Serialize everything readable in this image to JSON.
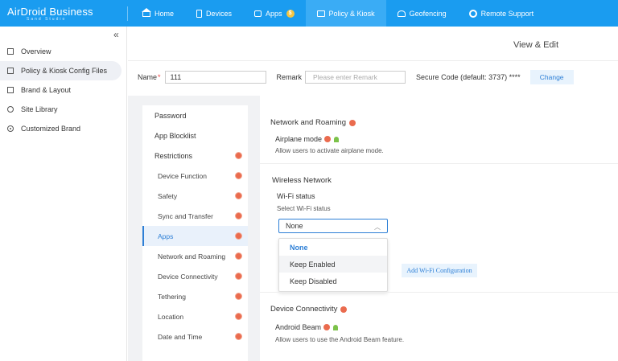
{
  "brand": {
    "title": "AirDroid Business",
    "subtitle": "Sand Studio"
  },
  "nav": [
    {
      "label": "Home",
      "icon": "home-icon"
    },
    {
      "label": "Devices",
      "icon": "device-icon"
    },
    {
      "label": "Apps",
      "icon": "apps-icon",
      "badge": "$"
    },
    {
      "label": "Policy & Kiosk",
      "icon": "folder-icon",
      "active": true
    },
    {
      "label": "Geofencing",
      "icon": "geofence-icon"
    },
    {
      "label": "Remote Support",
      "icon": "support-icon"
    }
  ],
  "sidebar": {
    "collapse": "«",
    "items": [
      {
        "label": "Overview",
        "icon": "overview-icon"
      },
      {
        "label": "Policy & Kiosk Config Files",
        "icon": "config-files-icon",
        "active": true
      },
      {
        "label": "Brand & Layout",
        "icon": "brand-icon"
      },
      {
        "label": "Site Library",
        "icon": "globe-icon"
      },
      {
        "label": "Customized Brand",
        "icon": "custom-brand-icon"
      }
    ]
  },
  "header": {
    "view_edit": "View & Edit"
  },
  "form": {
    "name_label": "Name",
    "required_mark": "*",
    "name_value": "111",
    "remark_label": "Remark",
    "remark_placeholder": "Please enter Remark",
    "secure_code": "Secure Code (default: 3737) ****",
    "change_label": "Change"
  },
  "tree": [
    {
      "label": "Password",
      "sub": false,
      "badge": false
    },
    {
      "label": "App Blocklist",
      "sub": false,
      "badge": false
    },
    {
      "label": "Restrictions",
      "sub": false,
      "badge": true
    },
    {
      "label": "Device Function",
      "sub": true,
      "badge": true
    },
    {
      "label": "Safety",
      "sub": true,
      "badge": true
    },
    {
      "label": "Sync and Transfer",
      "sub": true,
      "badge": true
    },
    {
      "label": "Apps",
      "sub": true,
      "badge": true,
      "active": true
    },
    {
      "label": "Network and Roaming",
      "sub": true,
      "badge": true
    },
    {
      "label": "Device Connectivity",
      "sub": true,
      "badge": true
    },
    {
      "label": "Tethering",
      "sub": true,
      "badge": true
    },
    {
      "label": "Location",
      "sub": true,
      "badge": true
    },
    {
      "label": "Date and Time",
      "sub": true,
      "badge": true
    }
  ],
  "content": {
    "network_title": "Network and Roaming",
    "airplane_label": "Airplane mode",
    "airplane_desc": "Allow users to activate airplane mode.",
    "wireless_title": "Wireless Network",
    "wifi_label": "Wi-Fi status",
    "wifi_desc": "Select Wi-Fi status",
    "wifi_value": "None",
    "wifi_options": [
      "None",
      "Keep Enabled",
      "Keep Disabled"
    ],
    "add_wifi_label": "Add Wi-Fi Configuration",
    "connectivity_title": "Device Connectivity",
    "beam_label": "Android Beam",
    "beam_desc": "Allow users to use the Android Beam feature."
  },
  "colors": {
    "topbar": "#1a9cf0",
    "accent": "#2d7fd6",
    "badge_red": "#ea6b4e",
    "android_green": "#7cc24a"
  }
}
